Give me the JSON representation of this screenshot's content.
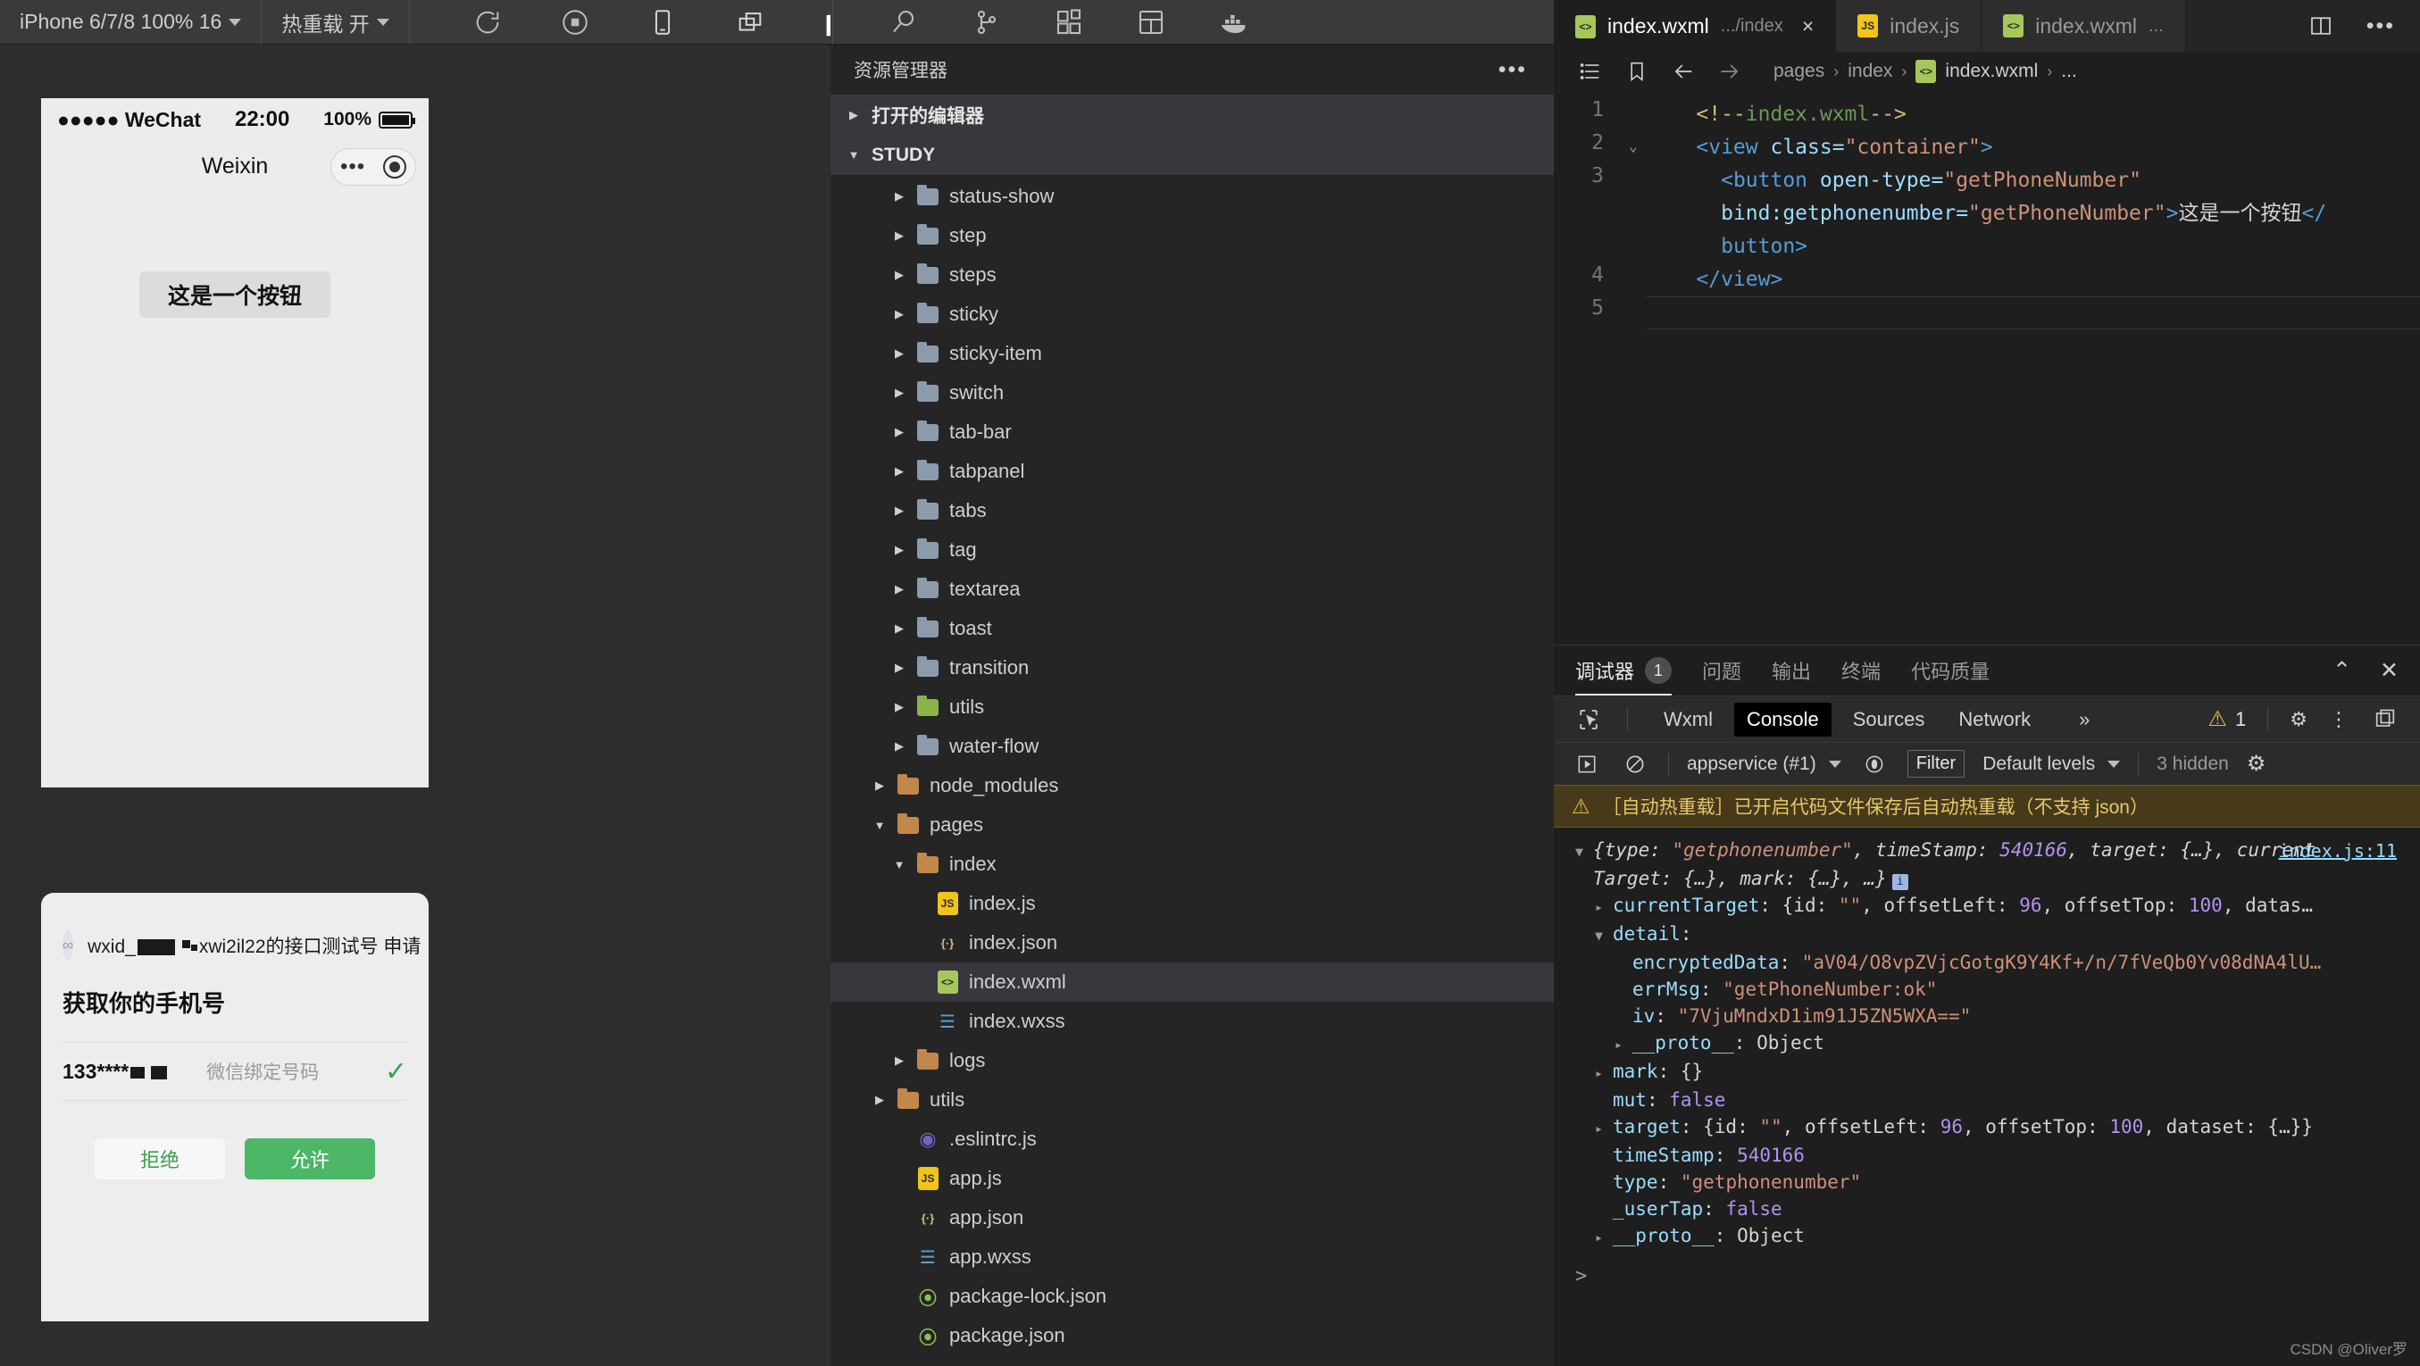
{
  "simulator": {
    "toolbar": {
      "device_label": "iPhone 6/7/8 100% 16",
      "hot_reload_label": "热重载 开",
      "icons": [
        "refresh-icon",
        "stop-record-icon",
        "phone-icon",
        "window-icon",
        "copy-files-icon"
      ]
    },
    "phone": {
      "status_bar": {
        "carrier": "●●●●● WeChat",
        "time": "22:00",
        "battery": "100%"
      },
      "nav_title": "Weixin",
      "button_label": "这是一个按钮"
    },
    "permission_sheet": {
      "app_name_prefix": "wxid_",
      "app_name_suffix": "xwi2il22的接口测试号",
      "app_name_action": "申请",
      "title": "获取你的手机号",
      "phone_masked": "133****",
      "phone_note": "微信绑定号码",
      "check_icon": "check-icon",
      "refuse_label": "拒绝",
      "allow_label": "允许",
      "allow_color": "#4bb767",
      "refuse_color": "#3ca050"
    }
  },
  "explorer": {
    "activity_icons": [
      "search-icon",
      "source-control-icon",
      "extensions-icon",
      "layout-icon",
      "docker-icon"
    ],
    "title": "资源管理器",
    "more_icon": "ellipsis-icon",
    "open_editors_label": "打开的编辑器",
    "workspace_label": "STUDY",
    "tree": [
      {
        "label": "status-show",
        "type": "folder",
        "indent": 2
      },
      {
        "label": "step",
        "type": "folder",
        "indent": 2
      },
      {
        "label": "steps",
        "type": "folder",
        "indent": 2
      },
      {
        "label": "sticky",
        "type": "folder",
        "indent": 2
      },
      {
        "label": "sticky-item",
        "type": "folder",
        "indent": 2
      },
      {
        "label": "switch",
        "type": "folder",
        "indent": 2
      },
      {
        "label": "tab-bar",
        "type": "folder",
        "indent": 2
      },
      {
        "label": "tabpanel",
        "type": "folder",
        "indent": 2
      },
      {
        "label": "tabs",
        "type": "folder",
        "indent": 2
      },
      {
        "label": "tag",
        "type": "folder",
        "indent": 2
      },
      {
        "label": "textarea",
        "type": "folder",
        "indent": 2
      },
      {
        "label": "toast",
        "type": "folder",
        "indent": 2
      },
      {
        "label": "transition",
        "type": "folder",
        "indent": 2
      },
      {
        "label": "utils",
        "type": "folder-green",
        "indent": 2
      },
      {
        "label": "water-flow",
        "type": "folder",
        "indent": 2
      },
      {
        "label": "node_modules",
        "type": "folder-open",
        "indent": 1
      },
      {
        "label": "pages",
        "type": "folder-open",
        "indent": 1,
        "expanded": true
      },
      {
        "label": "index",
        "type": "folder-open",
        "indent": 2,
        "expanded": true
      },
      {
        "label": "index.js",
        "type": "js",
        "indent": 3
      },
      {
        "label": "index.json",
        "type": "json",
        "indent": 3
      },
      {
        "label": "index.wxml",
        "type": "wxml",
        "indent": 3,
        "selected": true
      },
      {
        "label": "index.wxss",
        "type": "wxss",
        "indent": 3
      },
      {
        "label": "logs",
        "type": "folder-open",
        "indent": 2
      },
      {
        "label": "utils",
        "type": "folder-open",
        "indent": 1
      },
      {
        "label": ".eslintrc.js",
        "type": "eslint",
        "indent": 2
      },
      {
        "label": "app.js",
        "type": "js",
        "indent": 2
      },
      {
        "label": "app.json",
        "type": "json",
        "indent": 2
      },
      {
        "label": "app.wxss",
        "type": "wxss",
        "indent": 2
      },
      {
        "label": "package-lock.json",
        "type": "pkg",
        "indent": 2
      },
      {
        "label": "package.json",
        "type": "pkg",
        "indent": 2
      }
    ]
  },
  "editor": {
    "tabs": [
      {
        "label": "index.wxml",
        "sub": ".../index",
        "icon": "wxml-file-icon",
        "active": true,
        "close": "×"
      },
      {
        "label": "index.js",
        "sub": "",
        "icon": "js-file-icon",
        "active": false
      },
      {
        "label": "index.wxml",
        "sub": "...",
        "icon": "wxml-file-icon",
        "active": false
      }
    ],
    "tab_actions": [
      "split-editor-icon",
      "more-actions-icon"
    ],
    "breadcrumb_icons": [
      "outline-icon",
      "bookmark-icon",
      "back-arrow-icon",
      "forward-arrow-icon"
    ],
    "breadcrumb": [
      "pages",
      "index",
      "index.wxml",
      "..."
    ],
    "lines": [
      {
        "no": "1",
        "fold": "",
        "segs": [
          {
            "t": "    ",
            "c": "t-white"
          },
          {
            "t": "<!--",
            "c": "t-cbrack"
          },
          {
            "t": "index.wxml",
            "c": "t-comment"
          },
          {
            "t": "-->",
            "c": "t-cbrack"
          }
        ]
      },
      {
        "no": "2",
        "fold": "⌄",
        "segs": [
          {
            "t": "    ",
            "c": "t-white"
          },
          {
            "t": "<view ",
            "c": "t-tag"
          },
          {
            "t": "class=",
            "c": "t-attr"
          },
          {
            "t": "\"container\"",
            "c": "t-str"
          },
          {
            "t": ">",
            "c": "t-tag"
          }
        ]
      },
      {
        "no": "3",
        "fold": "",
        "segs": [
          {
            "t": "      ",
            "c": "t-white"
          },
          {
            "t": "<button ",
            "c": "t-tag"
          },
          {
            "t": "open-type=",
            "c": "t-attr"
          },
          {
            "t": "\"getPhoneNumber\"",
            "c": "t-str"
          }
        ]
      },
      {
        "no": "",
        "fold": "",
        "segs": [
          {
            "t": "      ",
            "c": "t-white"
          },
          {
            "t": "bind:getphonenumber=",
            "c": "t-attr"
          },
          {
            "t": "\"getPhoneNumber\"",
            "c": "t-str"
          },
          {
            "t": ">",
            "c": "t-tag"
          },
          {
            "t": "这是一个按钮",
            "c": "t-cn"
          },
          {
            "t": "</",
            "c": "t-tag"
          }
        ]
      },
      {
        "no": "",
        "fold": "",
        "segs": [
          {
            "t": "      ",
            "c": "t-white"
          },
          {
            "t": "button>",
            "c": "t-tag"
          }
        ]
      },
      {
        "no": "4",
        "fold": "",
        "segs": [
          {
            "t": "    ",
            "c": "t-white"
          },
          {
            "t": "</view>",
            "c": "t-tag"
          }
        ]
      },
      {
        "no": "5",
        "fold": "",
        "segs": []
      }
    ]
  },
  "panel": {
    "tabs": [
      {
        "label": "调试器",
        "count": "1",
        "active": true
      },
      {
        "label": "问题",
        "count": "",
        "active": false
      },
      {
        "label": "输出",
        "count": "",
        "active": false
      },
      {
        "label": "终端",
        "count": "",
        "active": false
      },
      {
        "label": "代码质量",
        "count": "",
        "active": false
      }
    ],
    "actions": [
      "collapse-panel-icon",
      "close-panel-icon"
    ],
    "devtools": {
      "inspect_icon": "inspect-element-icon",
      "tabs": [
        {
          "label": "Wxml",
          "active": false
        },
        {
          "label": "Console",
          "active": true
        },
        {
          "label": "Sources",
          "active": false
        },
        {
          "label": "Network",
          "active": false
        }
      ],
      "overflow": "»",
      "warning_icon": "warning-icon",
      "warning_count": "1",
      "right_icons": [
        "settings-gear-icon",
        "more-vertical-icon",
        "dock-panel-icon"
      ]
    },
    "filter_bar": {
      "run_icon": "execute-icon",
      "clear_icon": "clear-console-icon",
      "context": "appservice (#1)",
      "eye_icon": "live-expression-icon",
      "filter_placeholder": "Filter",
      "levels": "Default levels",
      "hidden": "3 hidden",
      "settings_icon": "console-settings-icon"
    },
    "warning_message": "［自动热重载］已开启代码文件保存后自动热重载（不支持 json）",
    "source_link": "index.js:11",
    "console_lines": [
      {
        "indent": 0,
        "tri": "▼",
        "segs": [
          {
            "t": "{type: ",
            "c": "k-plain ital"
          },
          {
            "t": "\"getphonenumber\"",
            "c": "k-str ital"
          },
          {
            "t": ", timeStamp: ",
            "c": "k-plain ital"
          },
          {
            "t": "540166",
            "c": "k-num ital"
          },
          {
            "t": ", target: {…}, current",
            "c": "k-plain ital"
          }
        ]
      },
      {
        "indent": 0,
        "tri": "",
        "segs": [
          {
            "t": "Target: {…}, mark: {…}, …}",
            "c": "k-plain ital"
          }
        ],
        "badge": "i"
      },
      {
        "indent": 1,
        "tri": "▸",
        "segs": [
          {
            "t": "currentTarget",
            "c": "k-prop"
          },
          {
            "t": ": {id: ",
            "c": "k-plain"
          },
          {
            "t": "\"\"",
            "c": "k-str"
          },
          {
            "t": ", offsetLeft: ",
            "c": "k-plain"
          },
          {
            "t": "96",
            "c": "k-num"
          },
          {
            "t": ", offsetTop: ",
            "c": "k-plain"
          },
          {
            "t": "100",
            "c": "k-num"
          },
          {
            "t": ", datas…",
            "c": "k-plain"
          }
        ]
      },
      {
        "indent": 1,
        "tri": "▼",
        "segs": [
          {
            "t": "detail",
            "c": "k-prop"
          },
          {
            "t": ":",
            "c": "k-plain"
          }
        ]
      },
      {
        "indent": 2,
        "tri": "",
        "segs": [
          {
            "t": "encryptedData",
            "c": "k-prop"
          },
          {
            "t": ": ",
            "c": "k-plain"
          },
          {
            "t": "\"aV04/O8vpZVjcGotgK9Y4Kf+/n/7fVeQb0Yv08dNA4lU…",
            "c": "k-str"
          }
        ]
      },
      {
        "indent": 2,
        "tri": "",
        "segs": [
          {
            "t": "errMsg",
            "c": "k-prop"
          },
          {
            "t": ": ",
            "c": "k-plain"
          },
          {
            "t": "\"getPhoneNumber:ok\"",
            "c": "k-str"
          }
        ]
      },
      {
        "indent": 2,
        "tri": "",
        "segs": [
          {
            "t": "iv",
            "c": "k-prop"
          },
          {
            "t": ": ",
            "c": "k-plain"
          },
          {
            "t": "\"7VjuMndxD1im91J5ZN5WXA==\"",
            "c": "k-str"
          }
        ]
      },
      {
        "indent": 2,
        "tri": "▸",
        "segs": [
          {
            "t": "__proto__",
            "c": "k-prop"
          },
          {
            "t": ": Object",
            "c": "k-plain"
          }
        ]
      },
      {
        "indent": 1,
        "tri": "▸",
        "segs": [
          {
            "t": "mark",
            "c": "k-prop"
          },
          {
            "t": ": {}",
            "c": "k-plain"
          }
        ]
      },
      {
        "indent": 1,
        "tri": "",
        "segs": [
          {
            "t": "mut",
            "c": "k-prop"
          },
          {
            "t": ": ",
            "c": "k-plain"
          },
          {
            "t": "false",
            "c": "k-bool"
          }
        ]
      },
      {
        "indent": 1,
        "tri": "▸",
        "segs": [
          {
            "t": "target",
            "c": "k-prop"
          },
          {
            "t": ": {id: ",
            "c": "k-plain"
          },
          {
            "t": "\"\"",
            "c": "k-str"
          },
          {
            "t": ", offsetLeft: ",
            "c": "k-plain"
          },
          {
            "t": "96",
            "c": "k-num"
          },
          {
            "t": ", offsetTop: ",
            "c": "k-plain"
          },
          {
            "t": "100",
            "c": "k-num"
          },
          {
            "t": ", dataset: {…}}",
            "c": "k-plain"
          }
        ]
      },
      {
        "indent": 1,
        "tri": "",
        "segs": [
          {
            "t": "timeStamp",
            "c": "k-prop"
          },
          {
            "t": ": ",
            "c": "k-plain"
          },
          {
            "t": "540166",
            "c": "k-num"
          }
        ]
      },
      {
        "indent": 1,
        "tri": "",
        "segs": [
          {
            "t": "type",
            "c": "k-prop"
          },
          {
            "t": ": ",
            "c": "k-plain"
          },
          {
            "t": "\"getphonenumber\"",
            "c": "k-str"
          }
        ]
      },
      {
        "indent": 1,
        "tri": "",
        "segs": [
          {
            "t": "_userTap",
            "c": "k-prop"
          },
          {
            "t": ": ",
            "c": "k-plain"
          },
          {
            "t": "false",
            "c": "k-bool"
          }
        ]
      },
      {
        "indent": 1,
        "tri": "▸",
        "segs": [
          {
            "t": "__proto__",
            "c": "k-prop"
          },
          {
            "t": ": Object",
            "c": "k-plain"
          }
        ]
      }
    ],
    "prompt": ">"
  },
  "watermark": "CSDN @Oliver罗"
}
